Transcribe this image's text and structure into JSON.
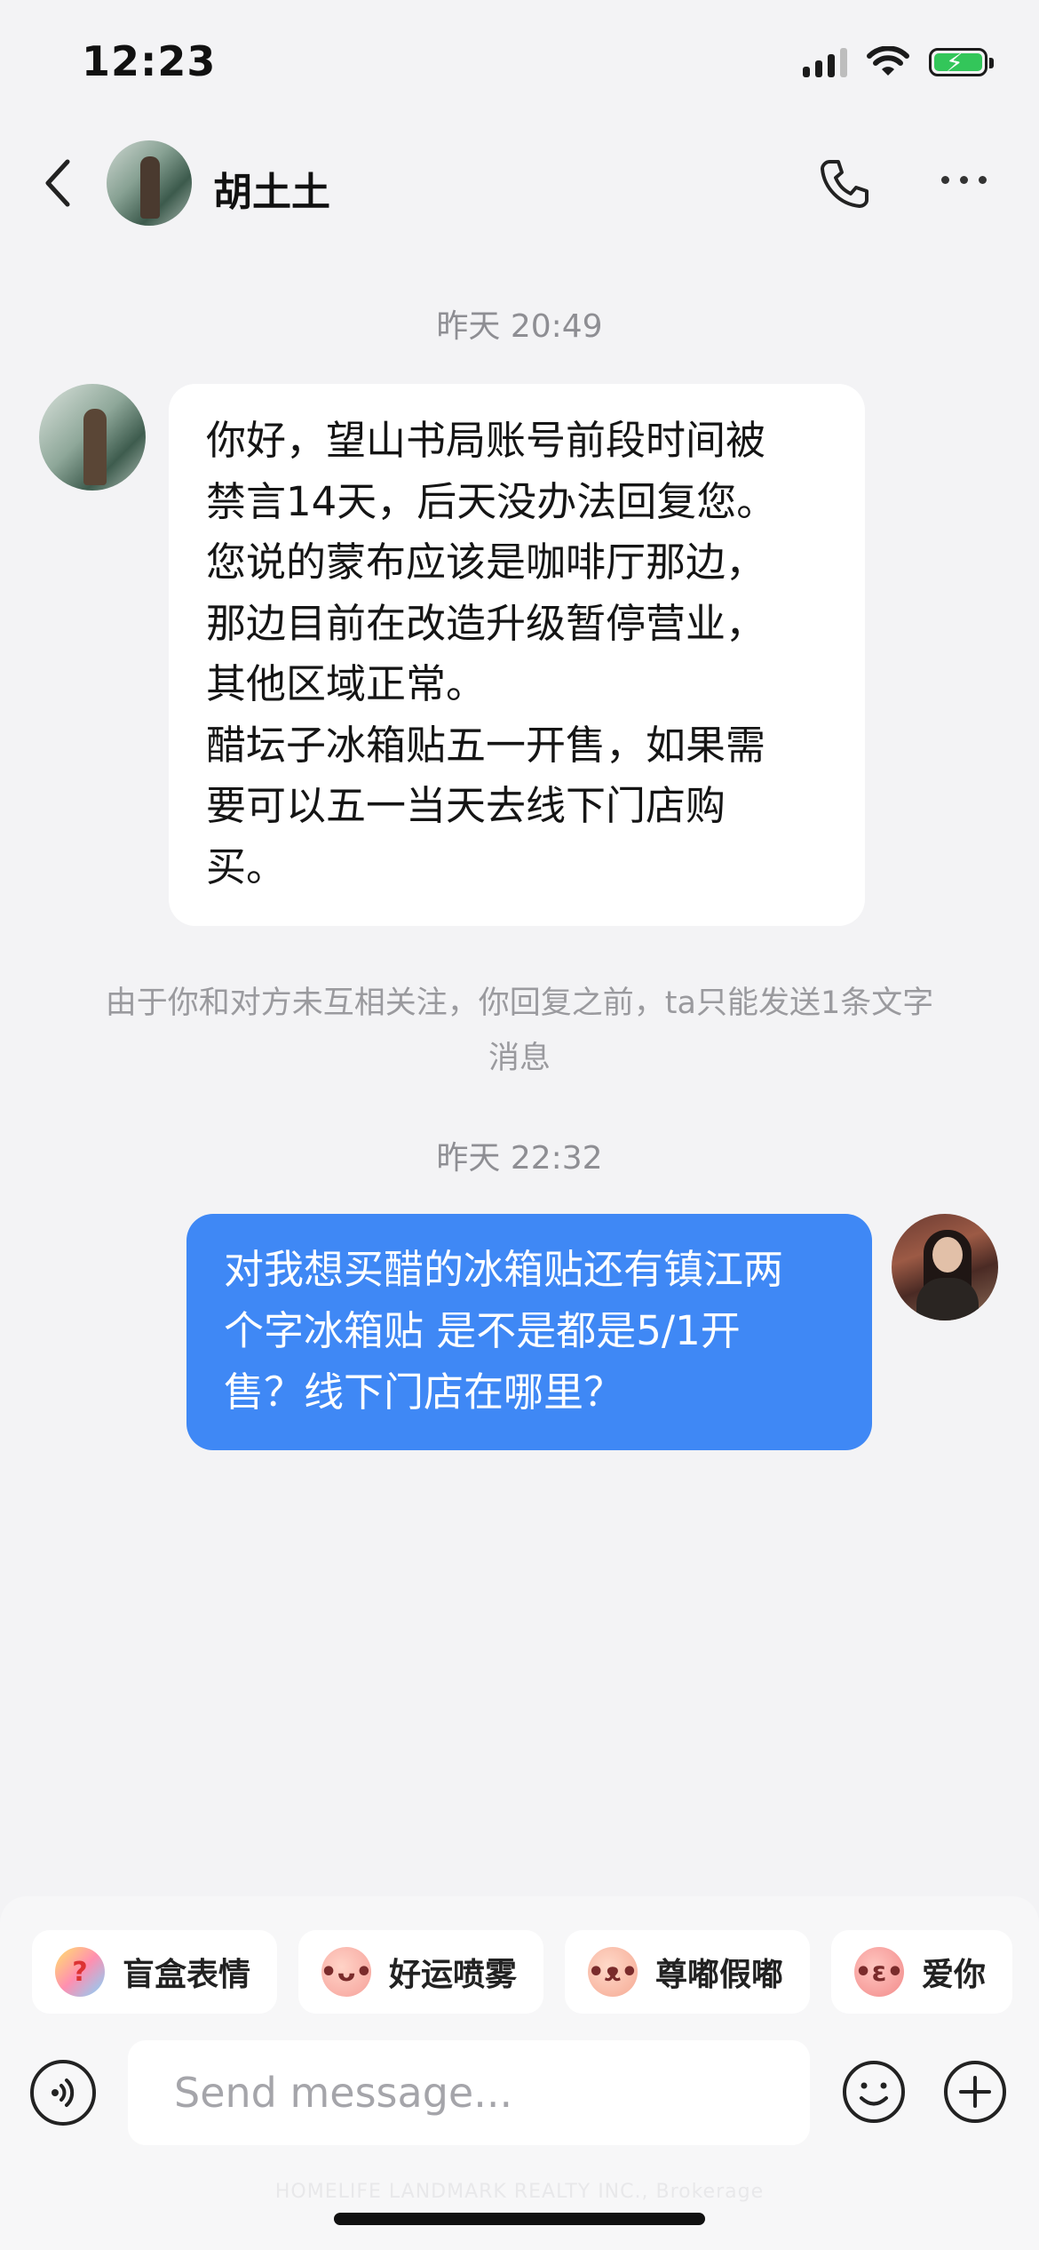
{
  "status_bar": {
    "time": "12:23"
  },
  "header": {
    "contact_name": "胡土土"
  },
  "conversation": {
    "timestamp_1": "昨天 20:49",
    "incoming_message_lines": [
      "你好，望山书局账号前段时间被",
      "禁言14天，后天没办法回复您。",
      "您说的蒙布应该是咖啡厅那边，",
      "那边目前在改造升级暂停营业，",
      "其他区域正常。",
      "醋坛子冰箱贴五一开售，如果需",
      "要可以五一当天去线下门店购",
      "买。"
    ],
    "notice_lines": [
      "由于你和对方未互相关注，你回复之前，ta只能发送1条文字",
      "消息"
    ],
    "timestamp_2": "昨天 22:32",
    "outgoing_message_lines": [
      "对我想买醋的冰箱贴还有镇江两",
      "个字冰箱贴 是不是都是5/1开",
      "售？线下门店在哪里？"
    ]
  },
  "sticker_chips": [
    {
      "label": "盲盒表情",
      "icon": "question-sticker-icon"
    },
    {
      "label": "好运喷雾",
      "icon": "lucky-spray-sticker-icon"
    },
    {
      "label": "尊嘟假嘟",
      "icon": "pig-sticker-icon"
    },
    {
      "label": "爱你",
      "icon": "love-sticker-icon"
    }
  ],
  "composer": {
    "placeholder": "Send message..."
  },
  "watermark": "HOMELIFE LANDMARK REALTY INC., Brokerage",
  "colors": {
    "outgoing_bubble": "#3f88f5",
    "background": "#f3f3f5",
    "battery": "#33c65a"
  }
}
